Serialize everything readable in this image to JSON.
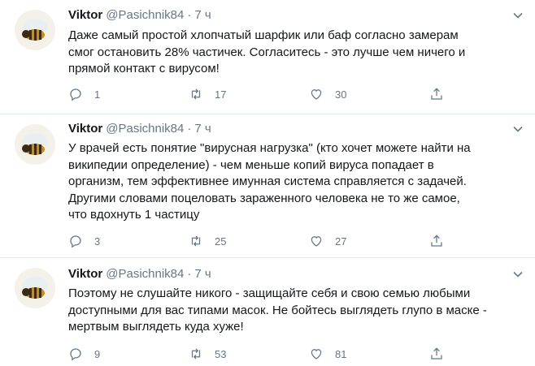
{
  "tweets": [
    {
      "name": "Viktor",
      "handle": "@Pasichnik84",
      "dot": "·",
      "time": "7 ч",
      "text": "Даже самый простой хлопчатый шарфик или баф согласно замерам\nсмог остановить 28% частичек. Согласитесь - это лучше чем ничего и\nпрямой контакт с вирусом!",
      "replies": "1",
      "retweets": "17",
      "likes": "30"
    },
    {
      "name": "Viktor",
      "handle": "@Pasichnik84",
      "dot": "·",
      "time": "7 ч",
      "text": "У врачей есть понятие \"вирусная нагрузка\" (кто хочет можете найти на\nвикипедии определение) - чем меньше копий вируса попадает в\nорганизм, тем эффективнее имунная система справляется с задачей.\nДругими словами поцеловать зараженного человека не то же самое,\nчто вдохнуть 1 частицу",
      "replies": "3",
      "retweets": "25",
      "likes": "27"
    },
    {
      "name": "Viktor",
      "handle": "@Pasichnik84",
      "dot": "·",
      "time": "7 ч",
      "text": "Поэтому не слушайте никого - защищайте себя и свою семью любыми\nдоступными для вас типами масок. Не бойтесь выглядеть глупо в маске -\nмертвым выглядеть куда хуже!",
      "replies": "9",
      "retweets": "53",
      "likes": "81"
    }
  ],
  "icons": {
    "avatar": "bee-avatar",
    "more": "chevron-down-icon",
    "reply": "reply-icon",
    "retweet": "retweet-icon",
    "like": "heart-icon",
    "share": "share-icon"
  },
  "colors": {
    "text": "#14171a",
    "secondary": "#657786",
    "divider": "#e6ecf0"
  }
}
